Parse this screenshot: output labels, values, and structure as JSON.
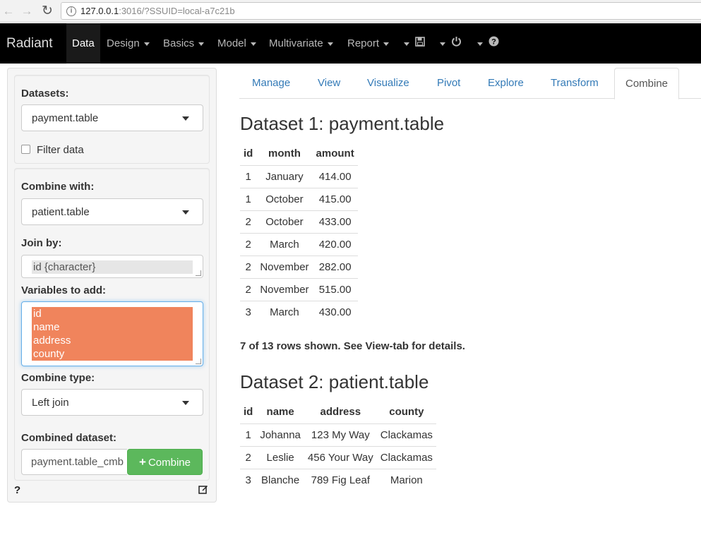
{
  "browser": {
    "url_host": "127.0.0.1",
    "url_rest": ":3016/?SSUID=local-a7c21b",
    "back_icon": "arrow-left-icon",
    "forward_icon": "arrow-right-icon",
    "reload_icon": "reload-icon"
  },
  "navbar": {
    "brand": "Radiant",
    "items": [
      "Data",
      "Design",
      "Basics",
      "Model",
      "Multivariate",
      "Report"
    ],
    "active": "Data",
    "icons": [
      "save-icon",
      "power-icon",
      "question-icon"
    ]
  },
  "sidebar": {
    "datasets_label": "Datasets:",
    "datasets_value": "payment.table",
    "filter_label": "Filter data",
    "combine_with_label": "Combine with:",
    "combine_with_value": "patient.table",
    "join_by_label": "Join by:",
    "join_by_value": "id {character}",
    "vars_label": "Variables to add:",
    "vars": [
      "id",
      "name",
      "address",
      "county"
    ],
    "combine_type_label": "Combine type:",
    "combine_type_value": "Left join",
    "combined_label": "Combined dataset:",
    "combined_value": "payment.table_cmb",
    "combine_button": "Combine",
    "help": "?"
  },
  "tabs": [
    "Manage",
    "View",
    "Visualize",
    "Pivot",
    "Explore",
    "Transform",
    "Combine"
  ],
  "active_tab": "Combine",
  "dataset1": {
    "title": "Dataset 1: payment.table",
    "columns": [
      "id",
      "month",
      "amount"
    ],
    "rows": [
      [
        "1",
        "January",
        "414.00"
      ],
      [
        "1",
        "October",
        "415.00"
      ],
      [
        "2",
        "October",
        "433.00"
      ],
      [
        "2",
        "March",
        "420.00"
      ],
      [
        "2",
        "November",
        "282.00"
      ],
      [
        "2",
        "November",
        "515.00"
      ],
      [
        "3",
        "March",
        "430.00"
      ]
    ],
    "note": "7 of 13 rows shown. See View-tab for details."
  },
  "dataset2": {
    "title": "Dataset 2: patient.table",
    "columns": [
      "id",
      "name",
      "address",
      "county"
    ],
    "rows": [
      [
        "1",
        "Johanna",
        "123 My Way",
        "Clackamas"
      ],
      [
        "2",
        "Leslie",
        "456 Your Way",
        "Clackamas"
      ],
      [
        "3",
        "Blanche",
        "789 Fig Leaf",
        "Marion"
      ]
    ]
  }
}
